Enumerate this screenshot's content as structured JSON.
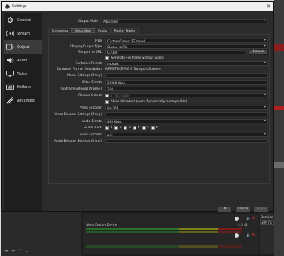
{
  "window": {
    "title": "Settings"
  },
  "sidebar": {
    "items": [
      {
        "label": "General",
        "icon": "gear-icon"
      },
      {
        "label": "Stream",
        "icon": "broadcast-icon"
      },
      {
        "label": "Output",
        "icon": "output-icon",
        "active": true
      },
      {
        "label": "Audio",
        "icon": "speaker-icon"
      },
      {
        "label": "Video",
        "icon": "monitor-icon"
      },
      {
        "label": "Hotkeys",
        "icon": "keyboard-icon"
      },
      {
        "label": "Advanced",
        "icon": "tools-icon"
      }
    ]
  },
  "output_mode": {
    "label": "Output Mode",
    "value": "Advanced"
  },
  "tabs": [
    "Streaming",
    "Recording",
    "Audio",
    "Replay Buffer"
  ],
  "active_tab": "Recording",
  "form": {
    "type": {
      "label": "Type",
      "value": "Custom Output (FFmpeg)"
    },
    "ffmpeg_output_type": {
      "label": "FFmpeg Output Type",
      "value": "Output to File"
    },
    "file_path": {
      "label": "File path or URL",
      "value": "C:/OBS",
      "browse": "Browse"
    },
    "generate_name": {
      "label": "Generate File Name without Space",
      "checked": false
    },
    "container_format": {
      "label": "Container Format",
      "value": "mpegts"
    },
    "container_desc": {
      "label": "Container Format Description",
      "value": "MPEG-TS (MPEG-2 Transport Stream)"
    },
    "muxer_settings": {
      "label": "Muxer Settings (if any)",
      "value": ""
    },
    "video_bitrate": {
      "label": "Video Bitrate",
      "value": "20000 Kbps"
    },
    "keyframe_interval": {
      "label": "Keyframe interval (frames)",
      "value": "250"
    },
    "rescale_output": {
      "label": "Rescale Output",
      "value": "1920x1080",
      "checked": false
    },
    "show_all_codecs": {
      "label": "Show all codecs (even if potentially incompatible)",
      "checked": true
    },
    "video_encoder": {
      "label": "Video Encoder",
      "value": "libx264"
    },
    "video_encoder_settings": {
      "label": "Video Encoder Settings (if any)",
      "value": ""
    },
    "audio_bitrate": {
      "label": "Audio Bitrate",
      "value": "480 Kbps"
    },
    "audio_track": {
      "label": "Audio Track",
      "tracks": [
        "1",
        "2",
        "3",
        "4",
        "5",
        "6"
      ],
      "checked": [
        true,
        false,
        false,
        false,
        false,
        false
      ]
    },
    "audio_encoder": {
      "label": "Audio Encoder",
      "value": "ac3"
    },
    "audio_encoder_settings": {
      "label": "Audio Encoder Settings (if any)",
      "value": ""
    }
  },
  "buttons": {
    "ok": "OK",
    "cancel": "Cancel",
    "apply": "Apply"
  },
  "dock": {
    "mixer_track": "Video Capture Device",
    "mixer_db": "-1.5 dB",
    "duration_label": "Duration",
    "duration_value": "300 ms"
  },
  "colors": {
    "window_bg": "#2b2b2b",
    "sidebar_bg": "#1e1e1e",
    "accent_red": "#c03030"
  }
}
